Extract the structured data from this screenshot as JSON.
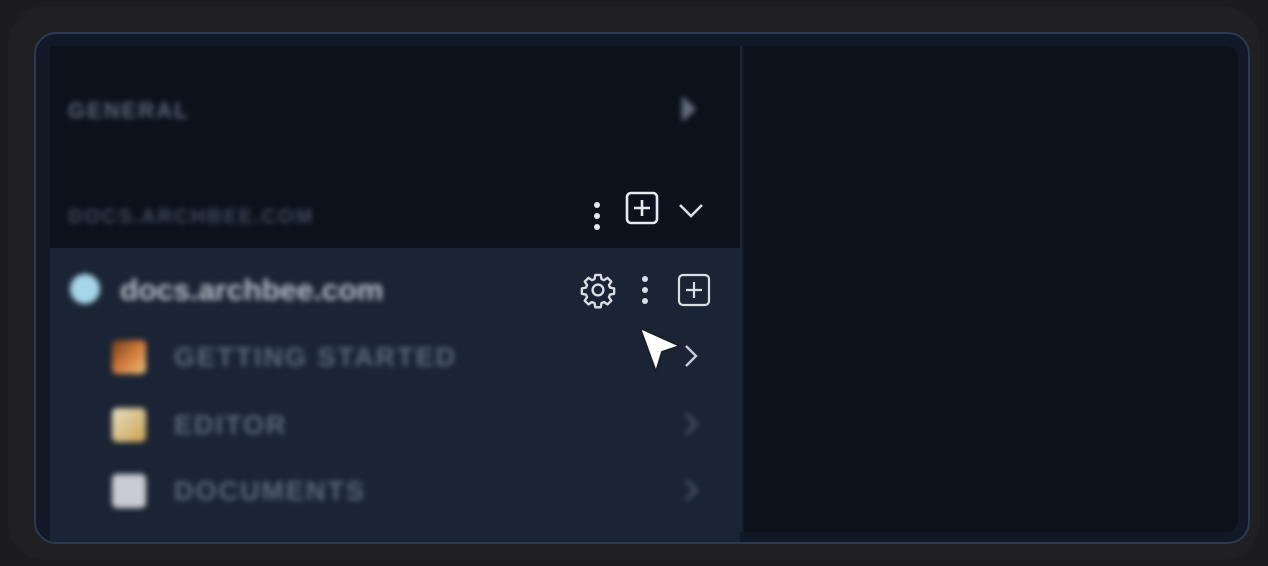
{
  "sidebar": {
    "general_label": "GENERAL",
    "space_label": "DOCS.ARCHBEE.COM",
    "site": {
      "name": "docs.archbee.com"
    },
    "items": [
      {
        "label": "GETTING STARTED",
        "icon": "guitar-icon"
      },
      {
        "label": "EDITOR",
        "icon": "memo-icon"
      },
      {
        "label": "DOCUMENTS",
        "icon": "page-icon"
      }
    ]
  },
  "icons": {
    "settings": "gear-icon",
    "more": "kebab-menu-icon",
    "add": "plus-square-icon",
    "expand": "chevron-down-icon",
    "forward": "chevron-right-icon",
    "pointer": "mouse-cursor-icon"
  },
  "colors": {
    "panel_bg": "#111927",
    "sidebar_bg": "#0d1420",
    "tree_bg": "#1a2434",
    "icon": "#d8dde6"
  }
}
